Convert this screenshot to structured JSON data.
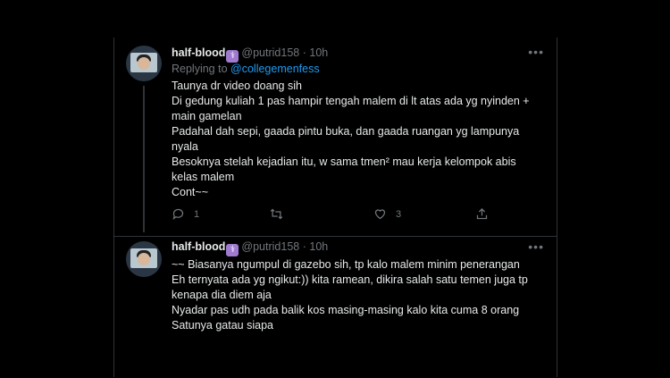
{
  "tweets": [
    {
      "name": "half-blood",
      "handle": "@putrid158",
      "separator": "·",
      "time": "10h",
      "reply_prefix": "Replying to",
      "reply_to": "@collegemenfess",
      "text": "Taunya dr video doang sih\nDi gedung kuliah 1 pas hampir tengah malem di lt atas ada yg nyinden +\nmain gamelan\nPadahal dah sepi, gaada pintu buka, dan gaada ruangan yg lampunya\nnyala\nBesoknya stelah kejadian itu, w sama tmen² mau kerja kelompok abis\nkelas malem\nCont~~",
      "replies": "1",
      "retweets": "",
      "likes": "3"
    },
    {
      "name": "half-blood",
      "handle": "@putrid158",
      "separator": "·",
      "time": "10h",
      "text": "~~ Biasanya ngumpul di gazebo sih, tp kalo malem minim penerangan\nEh ternyata ada yg ngikut:)) kita ramean, dikira salah satu temen juga tp\nkenapa dia diem aja\nNyadar pas udh pada balik kos masing-masing kalo kita cuma 8 orang\nSatunya gatau siapa"
    }
  ],
  "icons": {
    "more": "more-icon",
    "reply": "reply-icon",
    "retweet": "retweet-icon",
    "like": "like-icon",
    "share": "share-icon",
    "verified": "verified-badge-icon"
  },
  "colors": {
    "background": "#000000",
    "link": "#1d9bf0",
    "muted": "#71767b",
    "verified_badge": "#a07ad0"
  }
}
